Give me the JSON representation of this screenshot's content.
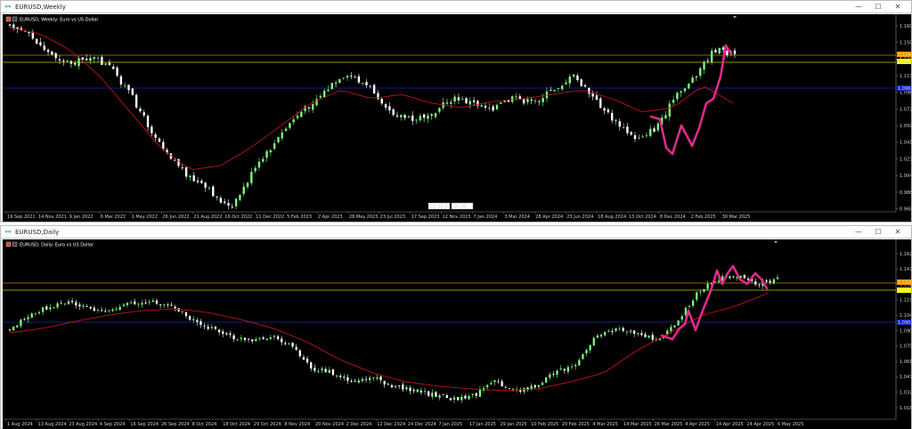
{
  "windows": [
    {
      "title": "EURUSD,Weekly",
      "legend": "EURUSD, Weekly:  Euro vs US Dollar",
      "price_labels": [
        "1.1605",
        "1.1500",
        "1.1245",
        "1.1135",
        "1.0960",
        "1.0770",
        "1.0595",
        "1.0415",
        "1.0235",
        "1.0045",
        "0.9865",
        "0.9680"
      ],
      "tag_labels": [
        "1.1246",
        "1.1245",
        "1.0960"
      ],
      "date_labels": [
        "19 Sep 2021",
        "14 Nov 2021",
        "9 Jan 2022",
        "6 Mar 2022",
        "1 May 2022",
        "26 Jun 2022",
        "21 Aug 2022",
        "16 Oct 2022",
        "11 Dec 2022",
        "5 Feb 2023",
        "2 Apr 2023",
        "28 May 2023",
        "23 Jul 2023",
        "17 Sep 2023",
        "12 Nov 2023",
        "7 Jan 2024",
        "3 Mar 2024",
        "28 Apr 2024",
        "23 Jun 2024",
        "18 Aug 2024",
        "13 Oct 2024",
        "8 Dec 2024",
        "2 Feb 2025",
        "30 Mar 2025"
      ],
      "crosshair_labels": [
        "21:30:00",
        "20:30"
      ]
    },
    {
      "title": "EURUSD,Daily",
      "legend": "EURUSD, Daily:  Euro vs US Dollar",
      "price_labels": [
        "1.16295",
        "1.14770",
        "1.13245",
        "1.11990",
        "1.10465",
        "1.09030",
        "1.07595",
        "1.06160",
        "1.04725",
        "1.03290",
        "1.01855"
      ],
      "tag_labels": [
        "1.13300",
        "1.12638",
        "1.09030"
      ],
      "date_labels": [
        "1 Aug 2024",
        "13 Aug 2024",
        "23 Aug 2024",
        "4 Sep 2024",
        "16 Sep 2024",
        "26 Sep 2024",
        "8 Oct 2024",
        "18 Oct 2024",
        "29 Oct 2024",
        "8 Nov 2024",
        "20 Nov 2024",
        "2 Dec 2024",
        "12 Dec 2024",
        "24 Dec 2024",
        "7 Jan 2025",
        "17 Jan 2025",
        "29 Jan 2025",
        "10 Feb 2025",
        "20 Feb 2025",
        "4 Mar 2025",
        "14 Mar 2025",
        "26 Mar 2025",
        "4 Apr 2025",
        "14 Apr 2025",
        "24 Apr 2025",
        "6 May 2025"
      ]
    }
  ],
  "colors": {
    "bull": "#7cfc7c",
    "bear": "#ffffff",
    "ma": "#c0141a",
    "hline_orange": "#c87e00",
    "hline_yellow": "#c8c800",
    "hline_blue": "#1428b4",
    "pattern": "#e0288c",
    "tag_yellow": "#ffff00",
    "tag_orange": "#ff9900",
    "tag_blue": "#1428d0"
  },
  "icons": {
    "app": "chart-app-icon",
    "minimize": "minimize-icon",
    "maximize": "maximize-icon",
    "close": "close-icon"
  },
  "controls": {
    "min": "—",
    "max": "☐",
    "close": "✕"
  }
}
